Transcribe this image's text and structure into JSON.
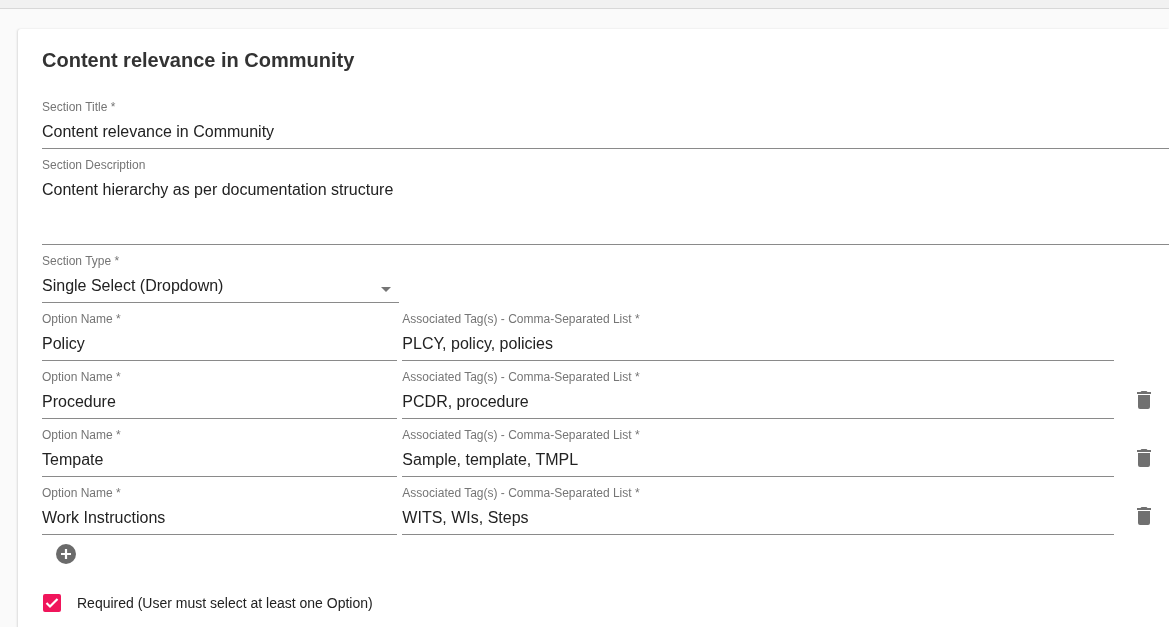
{
  "heading": "Content relevance in Community",
  "section_title": {
    "label": "Section Title *",
    "value": "Content relevance in Community"
  },
  "section_description": {
    "label": "Section Description",
    "value": "Content hierarchy as per documentation structure"
  },
  "section_type": {
    "label": "Section Type *",
    "value": "Single Select (Dropdown)"
  },
  "options": [
    {
      "name_label": "Option Name *",
      "name": "Policy",
      "tags_label": "Associated Tag(s) - Comma-Separated List *",
      "tags": "PLCY, policy, policies",
      "deletable": false
    },
    {
      "name_label": "Option Name *",
      "name": "Procedure",
      "tags_label": "Associated Tag(s) - Comma-Separated List *",
      "tags": "PCDR, procedure",
      "deletable": true
    },
    {
      "name_label": "Option Name *",
      "name": "Tempate",
      "tags_label": "Associated Tag(s) - Comma-Separated List *",
      "tags": "Sample, template, TMPL",
      "deletable": true
    },
    {
      "name_label": "Option Name *",
      "name": "Work Instructions",
      "tags_label": "Associated Tag(s) - Comma-Separated List *",
      "tags": "WITS, WIs, Steps",
      "deletable": true
    }
  ],
  "required": {
    "label": "Required (User must select at least one Option)",
    "checked": true
  }
}
